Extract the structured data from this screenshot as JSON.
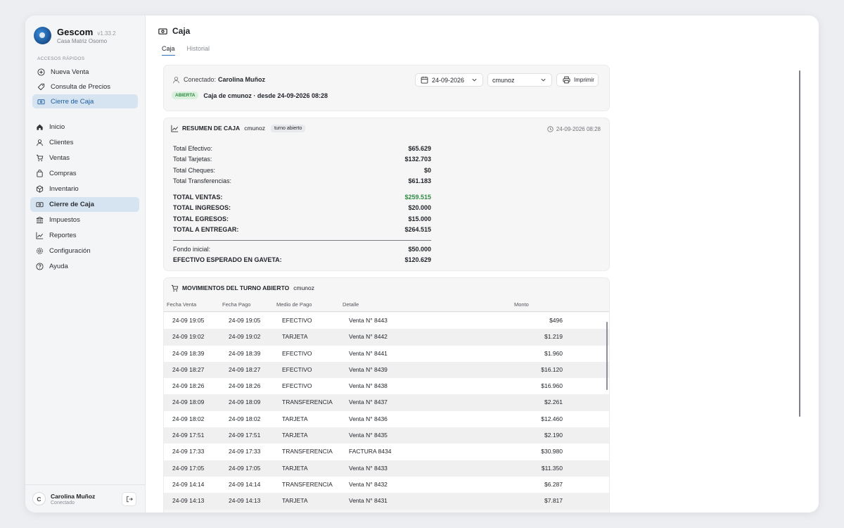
{
  "app": {
    "name": "Gescom",
    "version": "v1.33.2",
    "branch": "Casa Matriz Osorno"
  },
  "quick_access": {
    "label": "ACCESOS RÁPIDOS",
    "items": [
      {
        "label": "Nueva Venta",
        "icon": "plus-circle-icon"
      },
      {
        "label": "Consulta de Precios",
        "icon": "tag-icon"
      },
      {
        "label": "Cierre de Caja",
        "icon": "cash-icon",
        "active": true
      }
    ]
  },
  "nav": {
    "items": [
      {
        "label": "Inicio",
        "icon": "home-icon"
      },
      {
        "label": "Clientes",
        "icon": "user-icon"
      },
      {
        "label": "Ventas",
        "icon": "cart-icon"
      },
      {
        "label": "Compras",
        "icon": "bag-icon"
      },
      {
        "label": "Inventario",
        "icon": "box-icon"
      },
      {
        "label": "Cierre de Caja",
        "icon": "cash-icon",
        "active": true
      },
      {
        "label": "Impuestos",
        "icon": "bank-icon"
      },
      {
        "label": "Reportes",
        "icon": "chart-icon"
      },
      {
        "label": "Configuración",
        "icon": "gear-icon"
      },
      {
        "label": "Ayuda",
        "icon": "help-icon"
      }
    ]
  },
  "user": {
    "initial": "C",
    "name": "Carolina Muñoz",
    "status": "Conectado"
  },
  "page": {
    "title": "Caja",
    "tabs": [
      "Caja",
      "Historial"
    ]
  },
  "connection": {
    "label": "Conectado:",
    "user": "Carolina Muñoz",
    "badge": "ABIERTA",
    "status": "Caja de cmunoz · desde 24-09-2026 08:28",
    "date": "24-09-2026",
    "selected_user": "cmunoz",
    "print_label": "Imprimir"
  },
  "summary": {
    "title": "RESUMEN DE CAJA",
    "user": "cmunoz",
    "chip": "turno abierto",
    "timestamp": "24-09-2026 08:28",
    "payments": [
      {
        "label": "Total Efectivo:",
        "value": "$65.629"
      },
      {
        "label": "Total Tarjetas:",
        "value": "$132.703"
      },
      {
        "label": "Total Cheques:",
        "value": "$0"
      },
      {
        "label": "Total Transferencias:",
        "value": "$61.183"
      }
    ],
    "totals": [
      {
        "label": "TOTAL VENTAS:",
        "value": "$259.515"
      },
      {
        "label": "TOTAL INGRESOS:",
        "value": "$20.000"
      },
      {
        "label": "TOTAL EGRESOS:",
        "value": "$15.000"
      },
      {
        "label": "TOTAL A ENTREGAR:",
        "value": "$264.515"
      }
    ],
    "fondo": {
      "label": "Fondo inicial:",
      "value": "$50.000"
    },
    "esperado": {
      "label": "EFECTIVO ESPERADO EN GAVETA:",
      "value": "$120.629"
    },
    "accent": "#2e8a43"
  },
  "movements": {
    "title": "MOVIMIENTOS DEL TURNO ABIERTO",
    "user": "cmunoz",
    "columns": [
      "Fecha Venta",
      "Fecha Pago",
      "Medio de Pago",
      "Detalle",
      "Monto"
    ],
    "rows": [
      [
        "24-09 19:05",
        "24-09 19:05",
        "EFECTIVO",
        "Venta N° 8443",
        "$496"
      ],
      [
        "24-09 19:02",
        "24-09 19:02",
        "TARJETA",
        "Venta N° 8442",
        "$1.219"
      ],
      [
        "24-09 18:39",
        "24-09 18:39",
        "EFECTIVO",
        "Venta N° 8441",
        "$1.960"
      ],
      [
        "24-09 18:27",
        "24-09 18:27",
        "EFECTIVO",
        "Venta N° 8439",
        "$16.120"
      ],
      [
        "24-09 18:26",
        "24-09 18:26",
        "EFECTIVO",
        "Venta N° 8438",
        "$16.960"
      ],
      [
        "24-09 18:09",
        "24-09 18:09",
        "TRANSFERENCIA",
        "Venta N° 8437",
        "$2.261"
      ],
      [
        "24-09 18:02",
        "24-09 18:02",
        "TARJETA",
        "Venta N° 8436",
        "$12.460"
      ],
      [
        "24-09 17:51",
        "24-09 17:51",
        "TARJETA",
        "Venta N° 8435",
        "$2.190"
      ],
      [
        "24-09 17:33",
        "24-09 17:33",
        "TRANSFERENCIA",
        "FACTURA 8434",
        "$30.980"
      ],
      [
        "24-09 17:05",
        "24-09 17:05",
        "TARJETA",
        "Venta N° 8433",
        "$11.350"
      ],
      [
        "24-09 14:14",
        "24-09 14:14",
        "TRANSFERENCIA",
        "Venta N° 8432",
        "$6.287"
      ],
      [
        "24-09 14:13",
        "24-09 14:13",
        "TARJETA",
        "Venta N° 8431",
        "$7.817"
      ]
    ]
  }
}
